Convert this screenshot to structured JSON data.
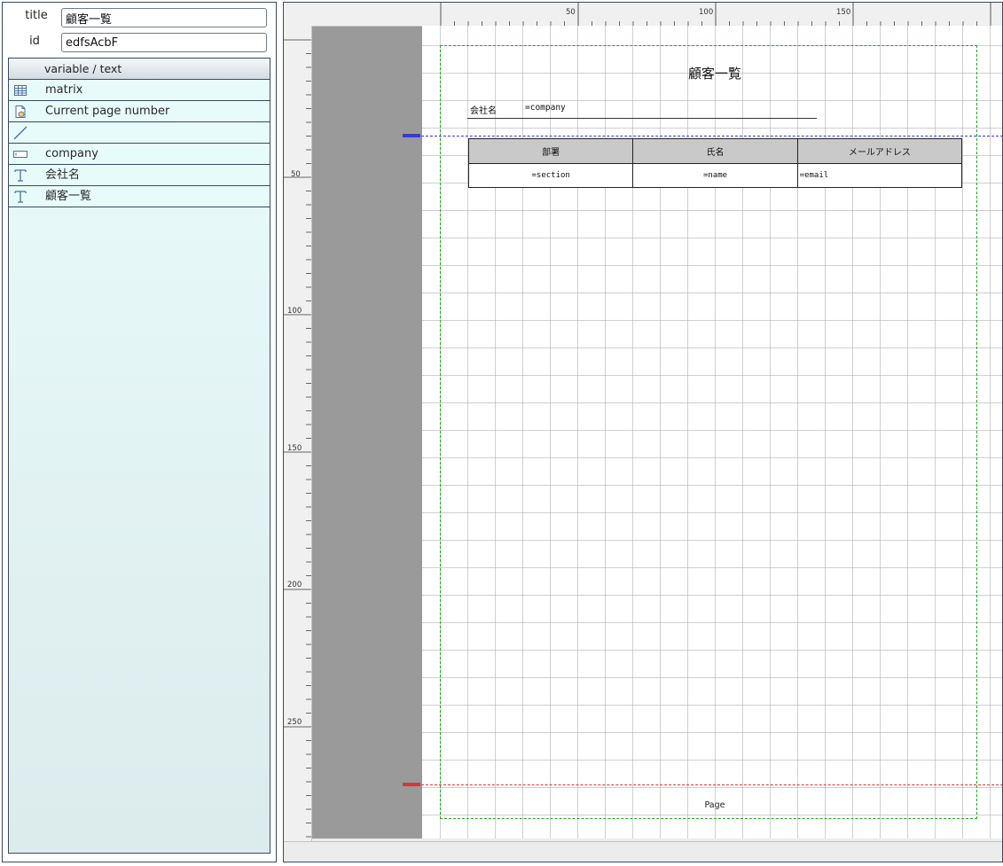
{
  "properties": {
    "title_label": "title",
    "title_value": "顧客一覧",
    "id_label": "id",
    "id_value": "edfsAcbF"
  },
  "object_list": {
    "header": "variable / text",
    "items": [
      {
        "label": "matrix",
        "icon": "matrix-icon"
      },
      {
        "label": "Current page number",
        "icon": "page-number-icon"
      },
      {
        "label": "",
        "icon": "line-icon"
      },
      {
        "label": "company",
        "icon": "variable-field-icon"
      },
      {
        "label": "会社名",
        "icon": "text-icon"
      },
      {
        "label": "顧客一覧",
        "icon": "text-icon"
      }
    ]
  },
  "ruler": {
    "top": [
      "50",
      "100",
      "150"
    ],
    "left": [
      "50",
      "100",
      "150",
      "200",
      "250"
    ]
  },
  "report": {
    "title": "顧客一覧",
    "company_label": "会社名",
    "company_variable": "=company",
    "table": {
      "headers": [
        "部署",
        "氏名",
        "メールアドレス"
      ],
      "row": [
        "=section",
        "=name",
        "=email"
      ]
    },
    "footer": "Page"
  },
  "colors": {
    "margin_guide": "#27a327",
    "header_band": "#3a3ad0",
    "footer_band": "#d03a3a",
    "list_bg": "#e8fbfb",
    "table_header_bg": "#c9c9c9"
  }
}
